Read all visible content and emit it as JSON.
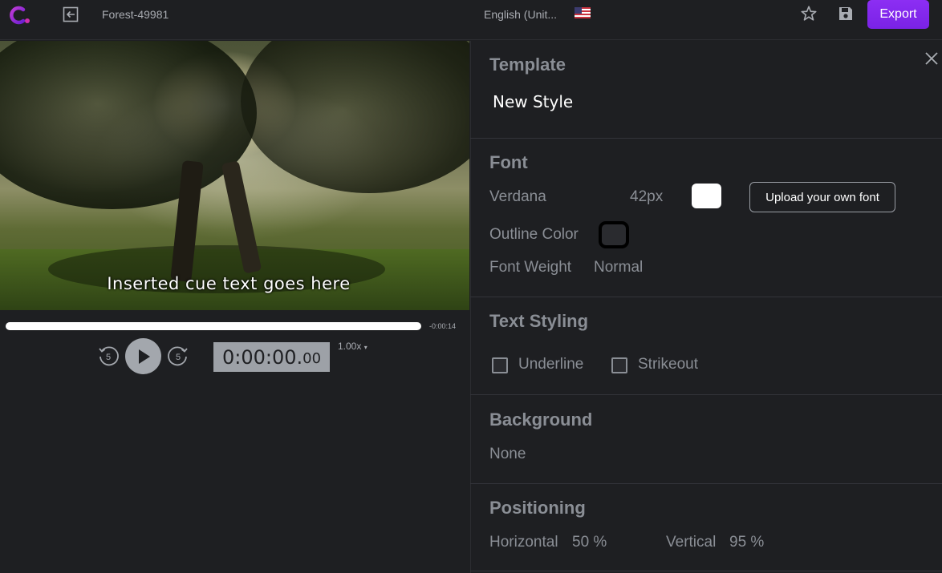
{
  "topbar": {
    "project_name": "Forest-49981",
    "language": "English (Unit...",
    "export_label": "Export"
  },
  "video": {
    "cue_text": "Inserted cue text goes here"
  },
  "player": {
    "duration": "-0:00:14",
    "rewind_seconds": "5",
    "forward_seconds": "5",
    "timecode_main": "0:00:00.",
    "timecode_frac": "00",
    "speed": "1.00x"
  },
  "panel": {
    "template": {
      "heading": "Template",
      "value": "New Style"
    },
    "font": {
      "heading": "Font",
      "family": "Verdana",
      "size": "42px",
      "upload_label": "Upload your own font",
      "outline_label": "Outline Color",
      "weight_label": "Font Weight",
      "weight_value": "Normal"
    },
    "text_styling": {
      "heading": "Text Styling",
      "underline": "Underline",
      "strikeout": "Strikeout"
    },
    "background": {
      "heading": "Background",
      "value": "None"
    },
    "positioning": {
      "heading": "Positioning",
      "horizontal_label": "Horizontal",
      "horizontal_value": "50 %",
      "vertical_label": "Vertical",
      "vertical_value": "95 %"
    }
  },
  "colors": {
    "accent": "#8c2ef3",
    "background": "#1e1f22",
    "font_color": "#ffffff",
    "outline_color": "#000000"
  },
  "icons": [
    "logo-icon",
    "exit-icon",
    "us-flag-icon",
    "star-icon",
    "save-icon",
    "rewind-5-icon",
    "play-icon",
    "forward-5-icon",
    "close-icon"
  ]
}
